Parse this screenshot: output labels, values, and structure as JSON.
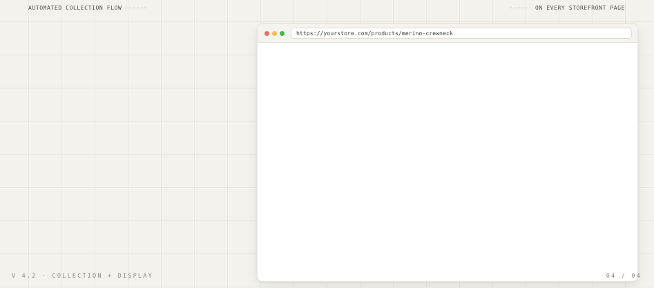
{
  "header": {
    "left_label": "AUTOMATED COLLECTION FLOW",
    "right_label": "ON EVERY STOREFRONT PAGE"
  },
  "footer": {
    "version_label": "V 4.2 · COLLECTION + DISPLAY",
    "page_counter": "04 / 04"
  },
  "browser": {
    "url": "https://yourstore.com/products/merino-crewneck",
    "controls": [
      "close",
      "minimize",
      "maximize"
    ]
  },
  "colors": {
    "background": "#f3f2ed",
    "close": "#ec6a5e",
    "minimize": "#f4be4f",
    "maximize": "#3fb950"
  }
}
